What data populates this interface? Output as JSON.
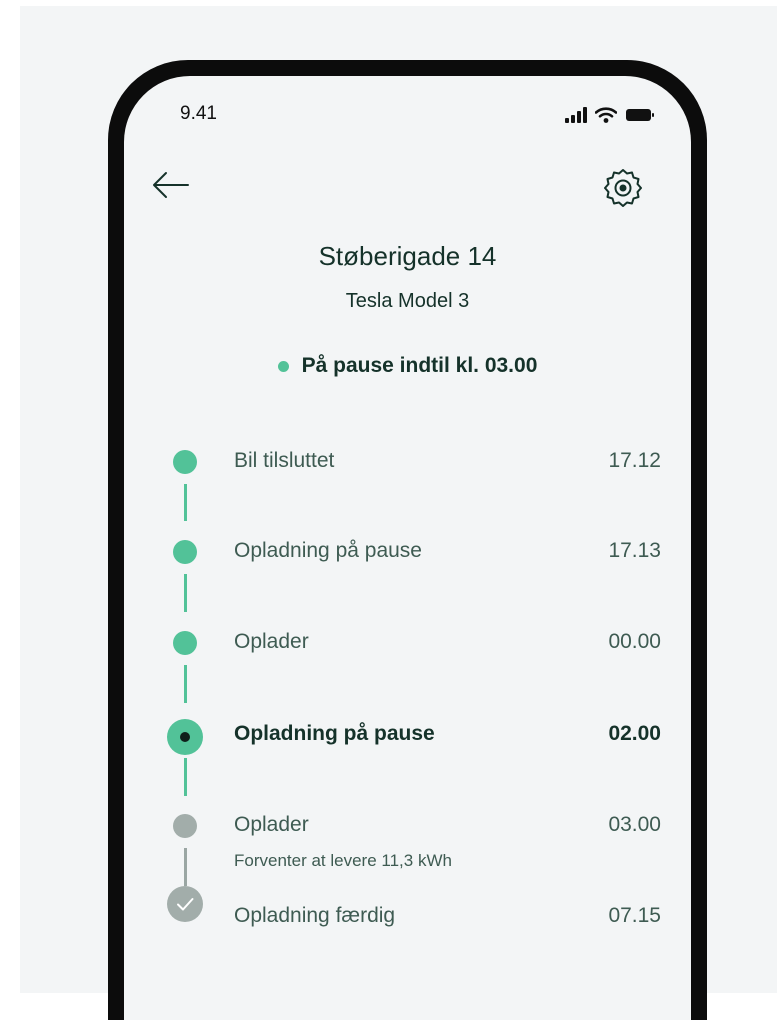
{
  "status_bar": {
    "time": "9.41"
  },
  "header": {
    "back_icon": "arrow-left-icon",
    "settings_icon": "gear-icon",
    "title": "Støberigade 14",
    "subtitle": "Tesla Model 3"
  },
  "charge_status": {
    "text": "På pause indtil kl. 03.00",
    "dot_color": "#52c298"
  },
  "timeline": {
    "items": [
      {
        "label": "Bil tilsluttet",
        "time": "17.12",
        "state": "done"
      },
      {
        "label": "Opladning på pause",
        "time": "17.13",
        "state": "done"
      },
      {
        "label": "Oplader",
        "time": "00.00",
        "state": "done"
      },
      {
        "label": "Opladning på pause",
        "time": "02.00",
        "state": "current"
      },
      {
        "label": "Oplader",
        "time": "03.00",
        "state": "upcoming",
        "note": "Forventer at levere 11,3 kWh"
      },
      {
        "label": "Opladning færdig",
        "time": "07.15",
        "state": "final"
      }
    ]
  },
  "colors": {
    "accent": "#52c298",
    "text": "#15322a",
    "muted": "#9aa6a3",
    "background": "#f3f5f6"
  }
}
